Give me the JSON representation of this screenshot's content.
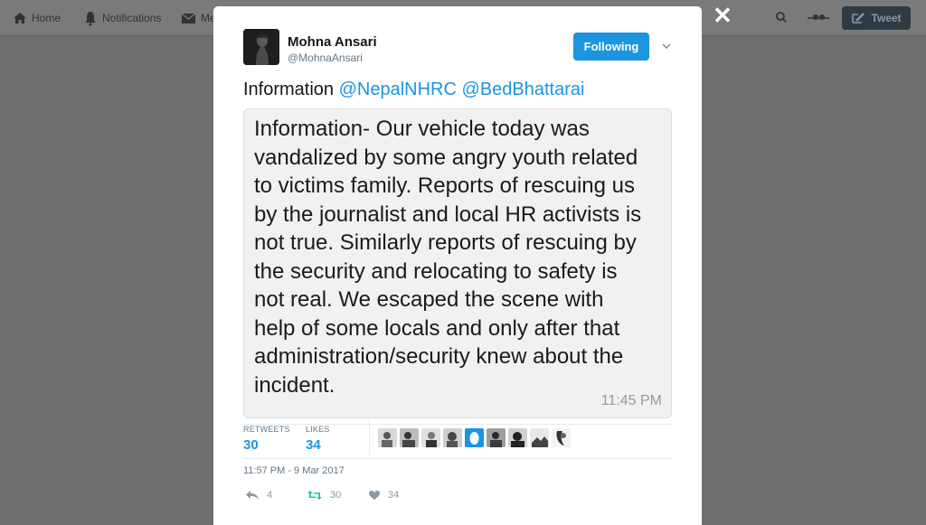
{
  "nav": {
    "home_label": "Home",
    "notifications_label": "Notifications",
    "messages_label": "Me",
    "tweet_button_label": "Tweet"
  },
  "tweet": {
    "author_name": "Mohna Ansari",
    "author_handle": "@MohnaAnsari",
    "follow_label": "Following",
    "text_prefix": "Information ",
    "mention_1": "@NepalNHRC",
    "mention_sep": " ",
    "mention_2": "@BedBhattarai",
    "image_lines": [
      "Information- Our vehicle today was",
      "vandalized by some angry youth related",
      "to victims family. Reports of rescuing us",
      "by the journalist and local HR  activists is",
      "not true. Similarly reports of rescuing by",
      "the security and relocating to safety is",
      "not real. We escaped the scene with",
      "help of some locals and only  after that",
      "administration/security knew about the",
      "incident."
    ],
    "image_time": "11:45 PM",
    "retweets_label": "RETWEETS",
    "retweets_count": "30",
    "likes_label": "LIKES",
    "likes_count": "34",
    "timestamp": "11:57 PM - 9 Mar 2017",
    "reply_count": "4",
    "retweet_count": "30",
    "like_count": "34"
  },
  "colors": {
    "accent": "#1b95e0",
    "overlay": "#6e6e6e"
  }
}
